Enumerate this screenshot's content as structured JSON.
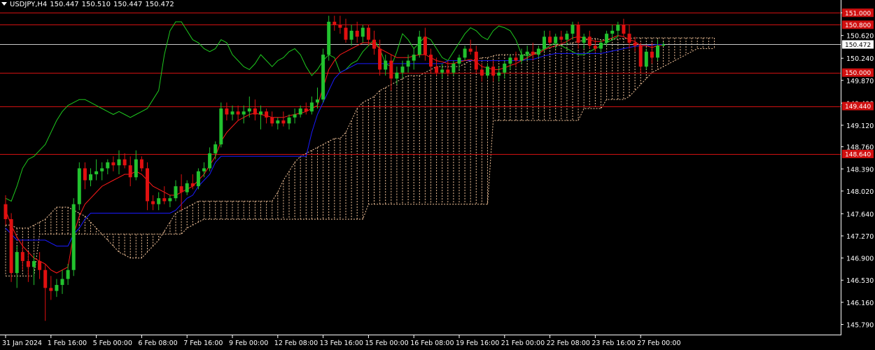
{
  "header": {
    "symbol": "USDJPY,H4",
    "open": "150.447",
    "high": "150.510",
    "low": "150.447",
    "close": "150.472"
  },
  "colors": {
    "background": "#000000",
    "bull": "#22c22e",
    "bear": "#e01010",
    "tenkan": "#ff1a1a",
    "kijun": "#1a1aff",
    "chikou": "#1ec81e",
    "cloud": "#f4c49a",
    "level_line": "#d01010",
    "price_line": "#c8c8c8",
    "axis": "#ffffff"
  },
  "chart_data": {
    "type": "candlestick",
    "symbol": "USDJPY",
    "timeframe": "H4",
    "ylim": [
      145.62,
      151.12
    ],
    "y_ticks": [
      "151.000",
      "150.620",
      "150.240",
      "149.870",
      "149.490",
      "149.120",
      "148.760",
      "148.390",
      "148.020",
      "147.640",
      "147.270",
      "146.900",
      "146.530",
      "146.160",
      "145.790"
    ],
    "x_ticks": [
      "31 Jan 2024",
      "1 Feb 16:00",
      "5 Feb 00:00",
      "6 Feb 08:00",
      "7 Feb 16:00",
      "9 Feb 00:00",
      "12 Feb 08:00",
      "13 Feb 16:00",
      "15 Feb 00:00",
      "16 Feb 08:00",
      "19 Feb 16:00",
      "21 Feb 00:00",
      "22 Feb 08:00",
      "23 Feb 16:00",
      "27 Feb 00:00"
    ],
    "x_tick_bar_index": [
      0,
      8,
      16,
      24,
      32,
      40,
      48,
      56,
      64,
      72,
      80,
      88,
      96,
      104,
      112
    ],
    "levels": [
      {
        "label": "151.000",
        "value": 151.0
      },
      {
        "label": "150.800",
        "value": 150.8
      },
      {
        "label": "150.000",
        "value": 150.0
      },
      {
        "label": "149.440",
        "value": 149.44
      },
      {
        "label": "148.640",
        "value": 148.64
      }
    ],
    "current_price": {
      "label": "150.472",
      "value": 150.472
    },
    "candles": [
      [
        147.8,
        147.95,
        147.45,
        147.55
      ],
      [
        147.55,
        147.65,
        146.5,
        146.65
      ],
      [
        146.65,
        147.1,
        146.4,
        147.0
      ],
      [
        147.0,
        147.2,
        146.7,
        146.85
      ],
      [
        146.85,
        147.0,
        146.5,
        146.75
      ],
      [
        146.75,
        146.95,
        146.45,
        146.85
      ],
      [
        146.85,
        147.0,
        146.55,
        146.7
      ],
      [
        146.7,
        146.8,
        145.85,
        146.4
      ],
      [
        146.4,
        146.6,
        146.2,
        146.35
      ],
      [
        146.35,
        146.55,
        146.25,
        146.45
      ],
      [
        146.45,
        146.7,
        146.3,
        146.55
      ],
      [
        146.55,
        146.8,
        146.45,
        146.7
      ],
      [
        146.7,
        147.9,
        146.6,
        147.8
      ],
      [
        147.8,
        148.5,
        147.7,
        148.4
      ],
      [
        148.4,
        148.5,
        148.05,
        148.2
      ],
      [
        148.2,
        148.4,
        148.1,
        148.3
      ],
      [
        148.3,
        148.55,
        148.2,
        148.35
      ],
      [
        148.35,
        148.5,
        148.2,
        148.4
      ],
      [
        148.4,
        148.55,
        148.3,
        148.5
      ],
      [
        148.5,
        148.6,
        148.35,
        148.45
      ],
      [
        148.45,
        148.7,
        148.3,
        148.55
      ],
      [
        148.55,
        148.65,
        148.4,
        148.45
      ],
      [
        148.45,
        148.6,
        148.1,
        148.25
      ],
      [
        148.25,
        148.7,
        148.2,
        148.55
      ],
      [
        148.55,
        148.6,
        148.35,
        148.4
      ],
      [
        148.4,
        148.5,
        147.7,
        147.85
      ],
      [
        147.85,
        147.95,
        147.7,
        147.8
      ],
      [
        147.8,
        148.0,
        147.7,
        147.9
      ],
      [
        147.9,
        148.1,
        147.8,
        147.85
      ],
      [
        147.85,
        147.95,
        147.75,
        147.9
      ],
      [
        147.9,
        148.2,
        147.85,
        148.1
      ],
      [
        148.1,
        148.3,
        147.7,
        148.0
      ],
      [
        148.0,
        148.2,
        147.95,
        148.15
      ],
      [
        148.15,
        148.3,
        148.05,
        148.1
      ],
      [
        148.1,
        148.4,
        148.05,
        148.35
      ],
      [
        148.35,
        148.5,
        148.25,
        148.4
      ],
      [
        148.4,
        148.75,
        148.35,
        148.65
      ],
      [
        148.65,
        148.85,
        148.55,
        148.8
      ],
      [
        148.8,
        149.5,
        148.75,
        149.4
      ],
      [
        149.4,
        149.5,
        149.2,
        149.3
      ],
      [
        149.3,
        149.45,
        149.2,
        149.35
      ],
      [
        149.35,
        149.45,
        149.2,
        149.3
      ],
      [
        149.3,
        149.45,
        149.15,
        149.35
      ],
      [
        149.35,
        149.6,
        149.25,
        149.4
      ],
      [
        149.4,
        149.55,
        149.2,
        149.3
      ],
      [
        149.3,
        149.45,
        149.05,
        149.35
      ],
      [
        149.35,
        149.4,
        149.15,
        149.25
      ],
      [
        149.25,
        149.35,
        149.1,
        149.15
      ],
      [
        149.15,
        149.25,
        149.05,
        149.2
      ],
      [
        149.2,
        149.35,
        149.1,
        149.15
      ],
      [
        149.15,
        149.3,
        149.05,
        149.25
      ],
      [
        149.25,
        149.4,
        149.15,
        149.3
      ],
      [
        149.3,
        149.45,
        149.25,
        149.4
      ],
      [
        149.4,
        149.5,
        149.3,
        149.35
      ],
      [
        149.35,
        149.6,
        149.3,
        149.5
      ],
      [
        149.5,
        149.75,
        149.4,
        149.55
      ],
      [
        149.55,
        150.4,
        149.5,
        150.3
      ],
      [
        150.3,
        150.95,
        150.2,
        150.85
      ],
      [
        150.85,
        150.95,
        150.7,
        150.8
      ],
      [
        150.8,
        150.95,
        150.65,
        150.75
      ],
      [
        150.75,
        150.9,
        150.5,
        150.55
      ],
      [
        150.55,
        150.8,
        150.45,
        150.7
      ],
      [
        150.7,
        150.85,
        150.5,
        150.6
      ],
      [
        150.6,
        150.8,
        150.5,
        150.75
      ],
      [
        150.75,
        150.8,
        150.45,
        150.55
      ],
      [
        150.55,
        150.7,
        150.3,
        150.4
      ],
      [
        150.4,
        150.55,
        149.95,
        150.05
      ],
      [
        150.05,
        150.3,
        149.95,
        150.2
      ],
      [
        150.2,
        150.3,
        149.7,
        149.9
      ],
      [
        149.9,
        150.1,
        149.8,
        150.0
      ],
      [
        150.0,
        150.2,
        149.9,
        150.1
      ],
      [
        150.1,
        150.3,
        150.0,
        150.2
      ],
      [
        150.2,
        150.4,
        150.05,
        150.3
      ],
      [
        150.3,
        150.7,
        150.25,
        150.6
      ],
      [
        150.6,
        150.75,
        150.2,
        150.3
      ],
      [
        150.3,
        150.4,
        150.0,
        150.1
      ],
      [
        150.1,
        150.25,
        149.95,
        150.0
      ],
      [
        150.0,
        150.15,
        149.9,
        150.05
      ],
      [
        150.05,
        150.2,
        149.95,
        150.0
      ],
      [
        150.0,
        150.2,
        149.95,
        150.15
      ],
      [
        150.15,
        150.3,
        150.05,
        150.25
      ],
      [
        150.25,
        150.45,
        150.2,
        150.4
      ],
      [
        150.4,
        150.55,
        150.3,
        150.35
      ],
      [
        150.35,
        150.45,
        150.0,
        150.05
      ],
      [
        150.05,
        150.15,
        149.85,
        149.95
      ],
      [
        149.95,
        150.15,
        149.9,
        150.1
      ],
      [
        150.1,
        150.2,
        149.85,
        149.95
      ],
      [
        149.95,
        150.1,
        149.85,
        150.0
      ],
      [
        150.0,
        150.2,
        149.9,
        150.15
      ],
      [
        150.15,
        150.3,
        150.05,
        150.25
      ],
      [
        150.25,
        150.35,
        150.1,
        150.2
      ],
      [
        150.2,
        150.4,
        150.15,
        150.3
      ],
      [
        150.3,
        150.45,
        150.2,
        150.35
      ],
      [
        150.35,
        150.5,
        150.2,
        150.3
      ],
      [
        150.3,
        150.45,
        150.25,
        150.4
      ],
      [
        150.4,
        150.7,
        150.35,
        150.6
      ],
      [
        150.6,
        150.7,
        150.45,
        150.5
      ],
      [
        150.5,
        150.65,
        150.4,
        150.6
      ],
      [
        150.6,
        150.7,
        150.5,
        150.55
      ],
      [
        150.55,
        150.7,
        150.45,
        150.65
      ],
      [
        150.65,
        150.85,
        150.55,
        150.8
      ],
      [
        150.8,
        150.85,
        150.4,
        150.5
      ],
      [
        150.5,
        150.65,
        150.4,
        150.6
      ],
      [
        150.6,
        150.7,
        150.4,
        150.45
      ],
      [
        150.45,
        150.55,
        150.35,
        150.4
      ],
      [
        150.4,
        150.55,
        150.35,
        150.5
      ],
      [
        150.5,
        150.7,
        150.45,
        150.65
      ],
      [
        150.65,
        150.8,
        150.55,
        150.7
      ],
      [
        150.7,
        150.85,
        150.6,
        150.8
      ],
      [
        150.8,
        150.9,
        150.6,
        150.65
      ],
      [
        150.65,
        150.8,
        150.4,
        150.5
      ],
      [
        150.5,
        150.6,
        150.35,
        150.45
      ],
      [
        150.45,
        150.5,
        150.0,
        150.1
      ],
      [
        150.1,
        150.4,
        150.05,
        150.35
      ],
      [
        150.35,
        150.5,
        150.15,
        150.25
      ],
      [
        150.25,
        150.55,
        150.2,
        150.45
      ],
      [
        150.45,
        150.51,
        150.44,
        150.47
      ]
    ],
    "tenkan": [
      147.7,
      147.45,
      147.25,
      147.1,
      147.0,
      146.9,
      146.85,
      146.8,
      146.7,
      146.65,
      146.7,
      146.75,
      147.3,
      147.6,
      147.8,
      147.9,
      148.0,
      148.1,
      148.15,
      148.2,
      148.25,
      148.3,
      148.3,
      148.35,
      148.3,
      148.2,
      148.1,
      148.05,
      148.0,
      147.95,
      147.95,
      148.0,
      148.05,
      148.1,
      148.2,
      148.3,
      148.45,
      148.6,
      148.85,
      149.0,
      149.1,
      149.2,
      149.25,
      149.3,
      149.32,
      149.3,
      149.28,
      149.25,
      149.25,
      149.25,
      149.28,
      149.3,
      149.32,
      149.35,
      149.4,
      149.45,
      149.75,
      150.05,
      150.2,
      150.3,
      150.35,
      150.4,
      150.45,
      150.5,
      150.5,
      150.48,
      150.4,
      150.35,
      150.3,
      150.25,
      150.25,
      150.25,
      150.28,
      150.3,
      150.3,
      150.25,
      150.2,
      150.18,
      150.15,
      150.15,
      150.18,
      150.2,
      150.22,
      150.18,
      150.1,
      150.08,
      150.05,
      150.05,
      150.08,
      150.12,
      150.15,
      150.2,
      150.25,
      150.3,
      150.32,
      150.38,
      150.42,
      150.45,
      150.48,
      150.52,
      150.58,
      150.6,
      150.58,
      150.55,
      150.52,
      150.52,
      150.55,
      150.58,
      150.62,
      150.6,
      150.55,
      150.52,
      150.45,
      150.45,
      150.42,
      150.45,
      150.46
    ],
    "kijun": [
      147.4,
      147.3,
      147.2,
      147.2,
      147.2,
      147.2,
      147.2,
      147.2,
      147.15,
      147.1,
      147.1,
      147.1,
      147.3,
      147.4,
      147.55,
      147.65,
      147.65,
      147.65,
      147.65,
      147.65,
      147.65,
      147.65,
      147.65,
      147.65,
      147.65,
      147.65,
      147.65,
      147.65,
      147.65,
      147.65,
      147.7,
      147.8,
      147.9,
      147.95,
      148.1,
      148.2,
      148.3,
      148.5,
      148.6,
      148.6,
      148.6,
      148.6,
      148.6,
      148.6,
      148.6,
      148.6,
      148.6,
      148.6,
      148.6,
      148.6,
      148.6,
      148.6,
      148.6,
      148.6,
      149.0,
      149.3,
      149.5,
      149.7,
      149.9,
      150.0,
      150.05,
      150.1,
      150.15,
      150.15,
      150.15,
      150.15,
      150.15,
      150.15,
      150.15,
      150.15,
      150.15,
      150.15,
      150.15,
      150.15,
      150.15,
      150.15,
      150.15,
      150.15,
      150.2,
      150.2,
      150.2,
      150.2,
      150.2,
      150.2,
      150.2,
      150.2,
      150.2,
      150.2,
      150.2,
      150.2,
      150.2,
      150.2,
      150.22,
      150.22,
      150.25,
      150.28,
      150.3,
      150.32,
      150.32,
      150.32,
      150.32,
      150.32,
      150.32,
      150.32,
      150.32,
      150.32,
      150.34,
      150.36,
      150.38,
      150.4,
      150.42,
      150.44,
      150.45,
      150.45,
      150.46,
      150.47,
      150.47
    ],
    "chikou_start_bar": 0,
    "chikou": [
      147.9,
      147.85,
      148.1,
      148.4,
      148.55,
      148.6,
      148.7,
      148.8,
      149.0,
      149.2,
      149.35,
      149.45,
      149.5,
      149.55,
      149.55,
      149.5,
      149.45,
      149.4,
      149.35,
      149.3,
      149.35,
      149.3,
      149.25,
      149.3,
      149.35,
      149.4,
      149.55,
      149.7,
      150.3,
      150.7,
      150.85,
      150.85,
      150.7,
      150.55,
      150.5,
      150.4,
      150.35,
      150.4,
      150.55,
      150.5,
      150.3,
      150.2,
      150.1,
      150.05,
      150.15,
      150.3,
      150.2,
      150.1,
      150.2,
      150.25,
      150.35,
      150.4,
      150.3,
      150.1,
      149.95,
      150.05,
      150.2,
      150.3,
      150.25,
      150.0,
      150.05,
      150.15,
      150.2,
      150.35,
      150.45,
      150.55,
      150.4,
      150.15,
      150.1,
      150.35,
      150.65,
      150.55,
      150.4,
      150.5,
      150.6,
      150.55,
      150.4,
      150.25,
      150.2,
      150.35,
      150.5,
      150.65,
      150.75,
      150.7,
      150.6,
      150.55,
      150.7,
      150.78,
      150.75,
      150.7,
      150.55,
      150.3,
      150.28,
      150.3,
      150.35,
      150.4,
      150.45,
      150.5,
      150.45,
      150.4,
      150.35,
      150.3,
      150.3,
      150.35,
      150.4,
      150.45,
      150.5,
      150.55,
      150.6
    ],
    "cloud_start_bar": 0,
    "span_a": [
      147.45,
      147.45,
      147.4,
      147.4,
      147.4,
      147.45,
      147.5,
      147.55,
      147.65,
      147.75,
      147.75,
      147.75,
      147.7,
      147.65,
      147.6,
      147.5,
      147.4,
      147.3,
      147.2,
      147.1,
      147.0,
      146.95,
      146.9,
      146.9,
      146.9,
      147.0,
      147.1,
      147.2,
      147.35,
      147.5,
      147.65,
      147.7,
      147.75,
      147.8,
      147.85,
      147.85,
      147.85,
      147.85,
      147.85,
      147.85,
      147.85,
      147.85,
      147.85,
      147.85,
      147.85,
      147.85,
      147.85,
      147.85,
      148.0,
      148.2,
      148.35,
      148.5,
      148.6,
      148.65,
      148.7,
      148.75,
      148.8,
      148.85,
      148.9,
      148.9,
      149.0,
      149.2,
      149.4,
      149.5,
      149.55,
      149.6,
      149.7,
      149.75,
      149.8,
      149.85,
      149.9,
      149.95,
      149.95,
      149.95,
      150.0,
      150.05,
      150.1,
      150.1,
      150.1,
      150.1,
      150.1,
      150.15,
      150.2,
      150.22,
      150.25,
      150.25,
      150.28,
      150.3,
      150.3,
      150.3,
      150.3,
      150.3,
      150.3,
      150.32,
      150.35,
      150.4,
      150.42,
      150.44,
      150.46,
      150.48,
      150.5,
      150.52,
      150.54,
      150.56,
      150.57,
      150.55,
      150.55,
      150.56,
      150.56,
      150.57,
      150.57,
      150.58,
      150.58,
      150.58,
      150.58,
      150.58,
      150.58,
      150.58,
      150.58,
      150.58,
      150.58,
      150.58,
      150.58,
      150.58,
      150.58,
      150.58
    ],
    "span_b": [
      146.6,
      146.6,
      146.6,
      146.6,
      146.6,
      146.6,
      147.3,
      147.3,
      147.3,
      147.3,
      147.3,
      147.3,
      147.3,
      147.3,
      147.3,
      147.3,
      147.3,
      147.3,
      147.3,
      147.3,
      147.3,
      147.3,
      147.3,
      147.3,
      147.3,
      147.3,
      147.3,
      147.3,
      147.3,
      147.3,
      147.3,
      147.3,
      147.4,
      147.45,
      147.5,
      147.55,
      147.55,
      147.55,
      147.55,
      147.55,
      147.55,
      147.55,
      147.55,
      147.55,
      147.55,
      147.55,
      147.55,
      147.55,
      147.55,
      147.55,
      147.55,
      147.55,
      147.55,
      147.55,
      147.55,
      147.55,
      147.55,
      147.55,
      147.55,
      147.55,
      147.55,
      147.55,
      147.55,
      147.55,
      147.8,
      147.8,
      147.8,
      147.8,
      147.8,
      147.8,
      147.8,
      147.8,
      147.8,
      147.8,
      147.8,
      147.8,
      147.8,
      147.8,
      147.8,
      147.8,
      147.8,
      147.8,
      147.8,
      147.8,
      147.8,
      147.8,
      149.2,
      149.2,
      149.2,
      149.2,
      149.2,
      149.2,
      149.2,
      149.2,
      149.2,
      149.2,
      149.2,
      149.2,
      149.2,
      149.2,
      149.2,
      149.2,
      149.4,
      149.4,
      149.4,
      149.4,
      149.55,
      149.55,
      149.55,
      149.55,
      149.6,
      149.7,
      149.8,
      149.9,
      150.0,
      150.05,
      150.1,
      150.15,
      150.2,
      150.25,
      150.3,
      150.35,
      150.4,
      150.4,
      150.4,
      150.4
    ]
  }
}
